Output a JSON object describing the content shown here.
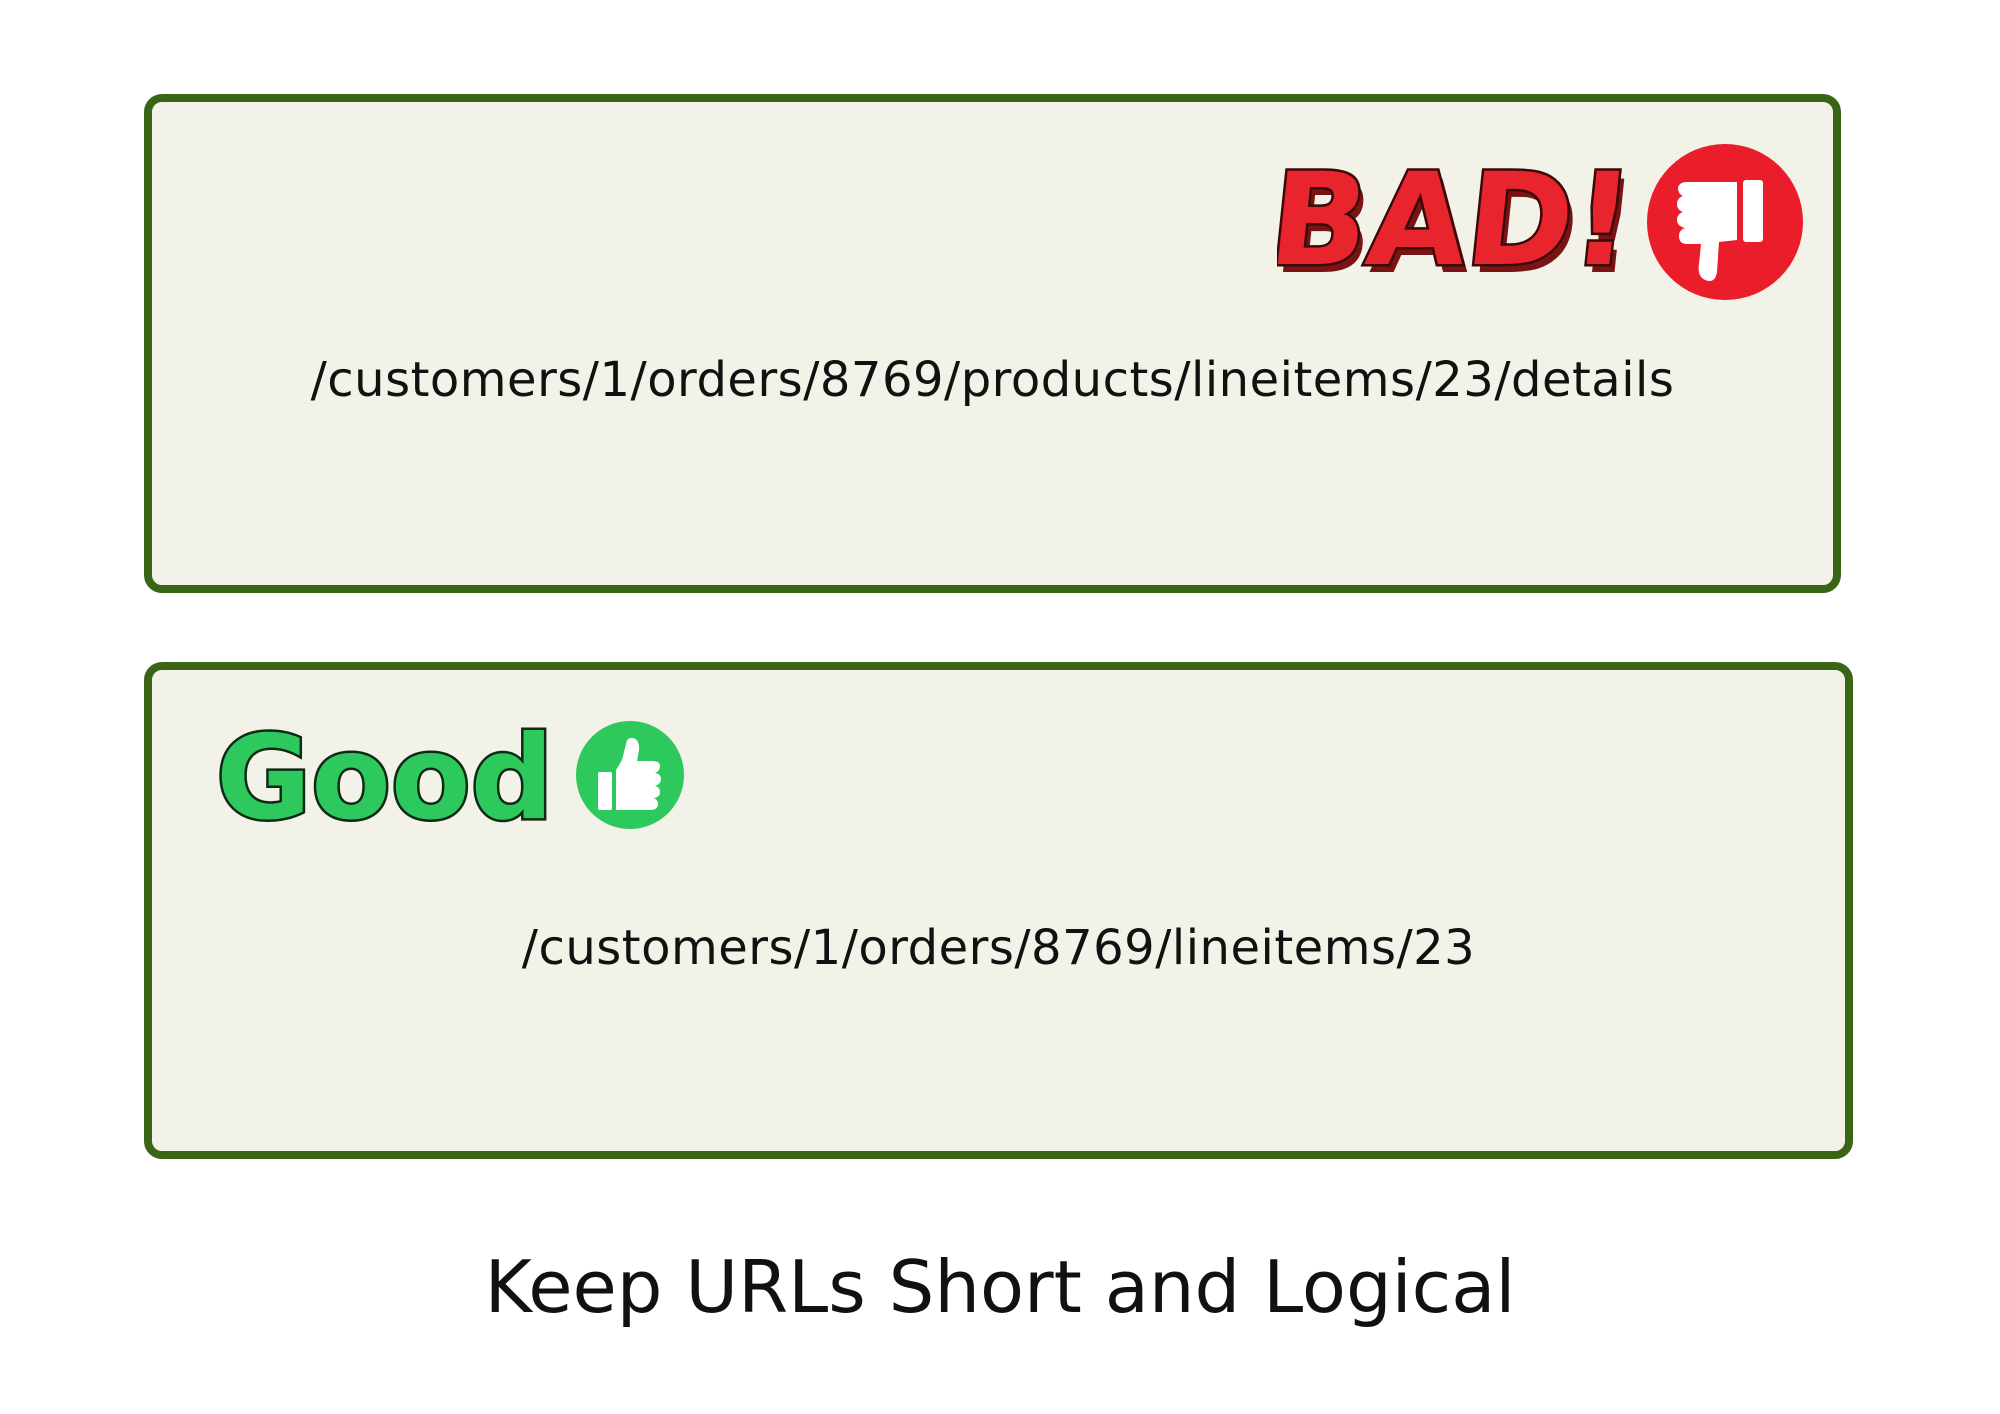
{
  "panels": {
    "bad": {
      "label": "BAD!",
      "url": "/customers/1/orders/8769/products/lineitems/23/details",
      "icon": "thumbs-down-icon",
      "label_color": "#e8242c",
      "icon_color": "#ea1d2a"
    },
    "good": {
      "label": "Good",
      "url": "/customers/1/orders/8769/lineitems/23",
      "icon": "thumbs-up-icon",
      "label_color": "#2ec95c",
      "icon_color": "#2ec95c"
    }
  },
  "caption": "Keep URLs Short and Logical",
  "colors": {
    "panel_border": "#3b6516",
    "panel_fill": "#f2f2e8"
  }
}
